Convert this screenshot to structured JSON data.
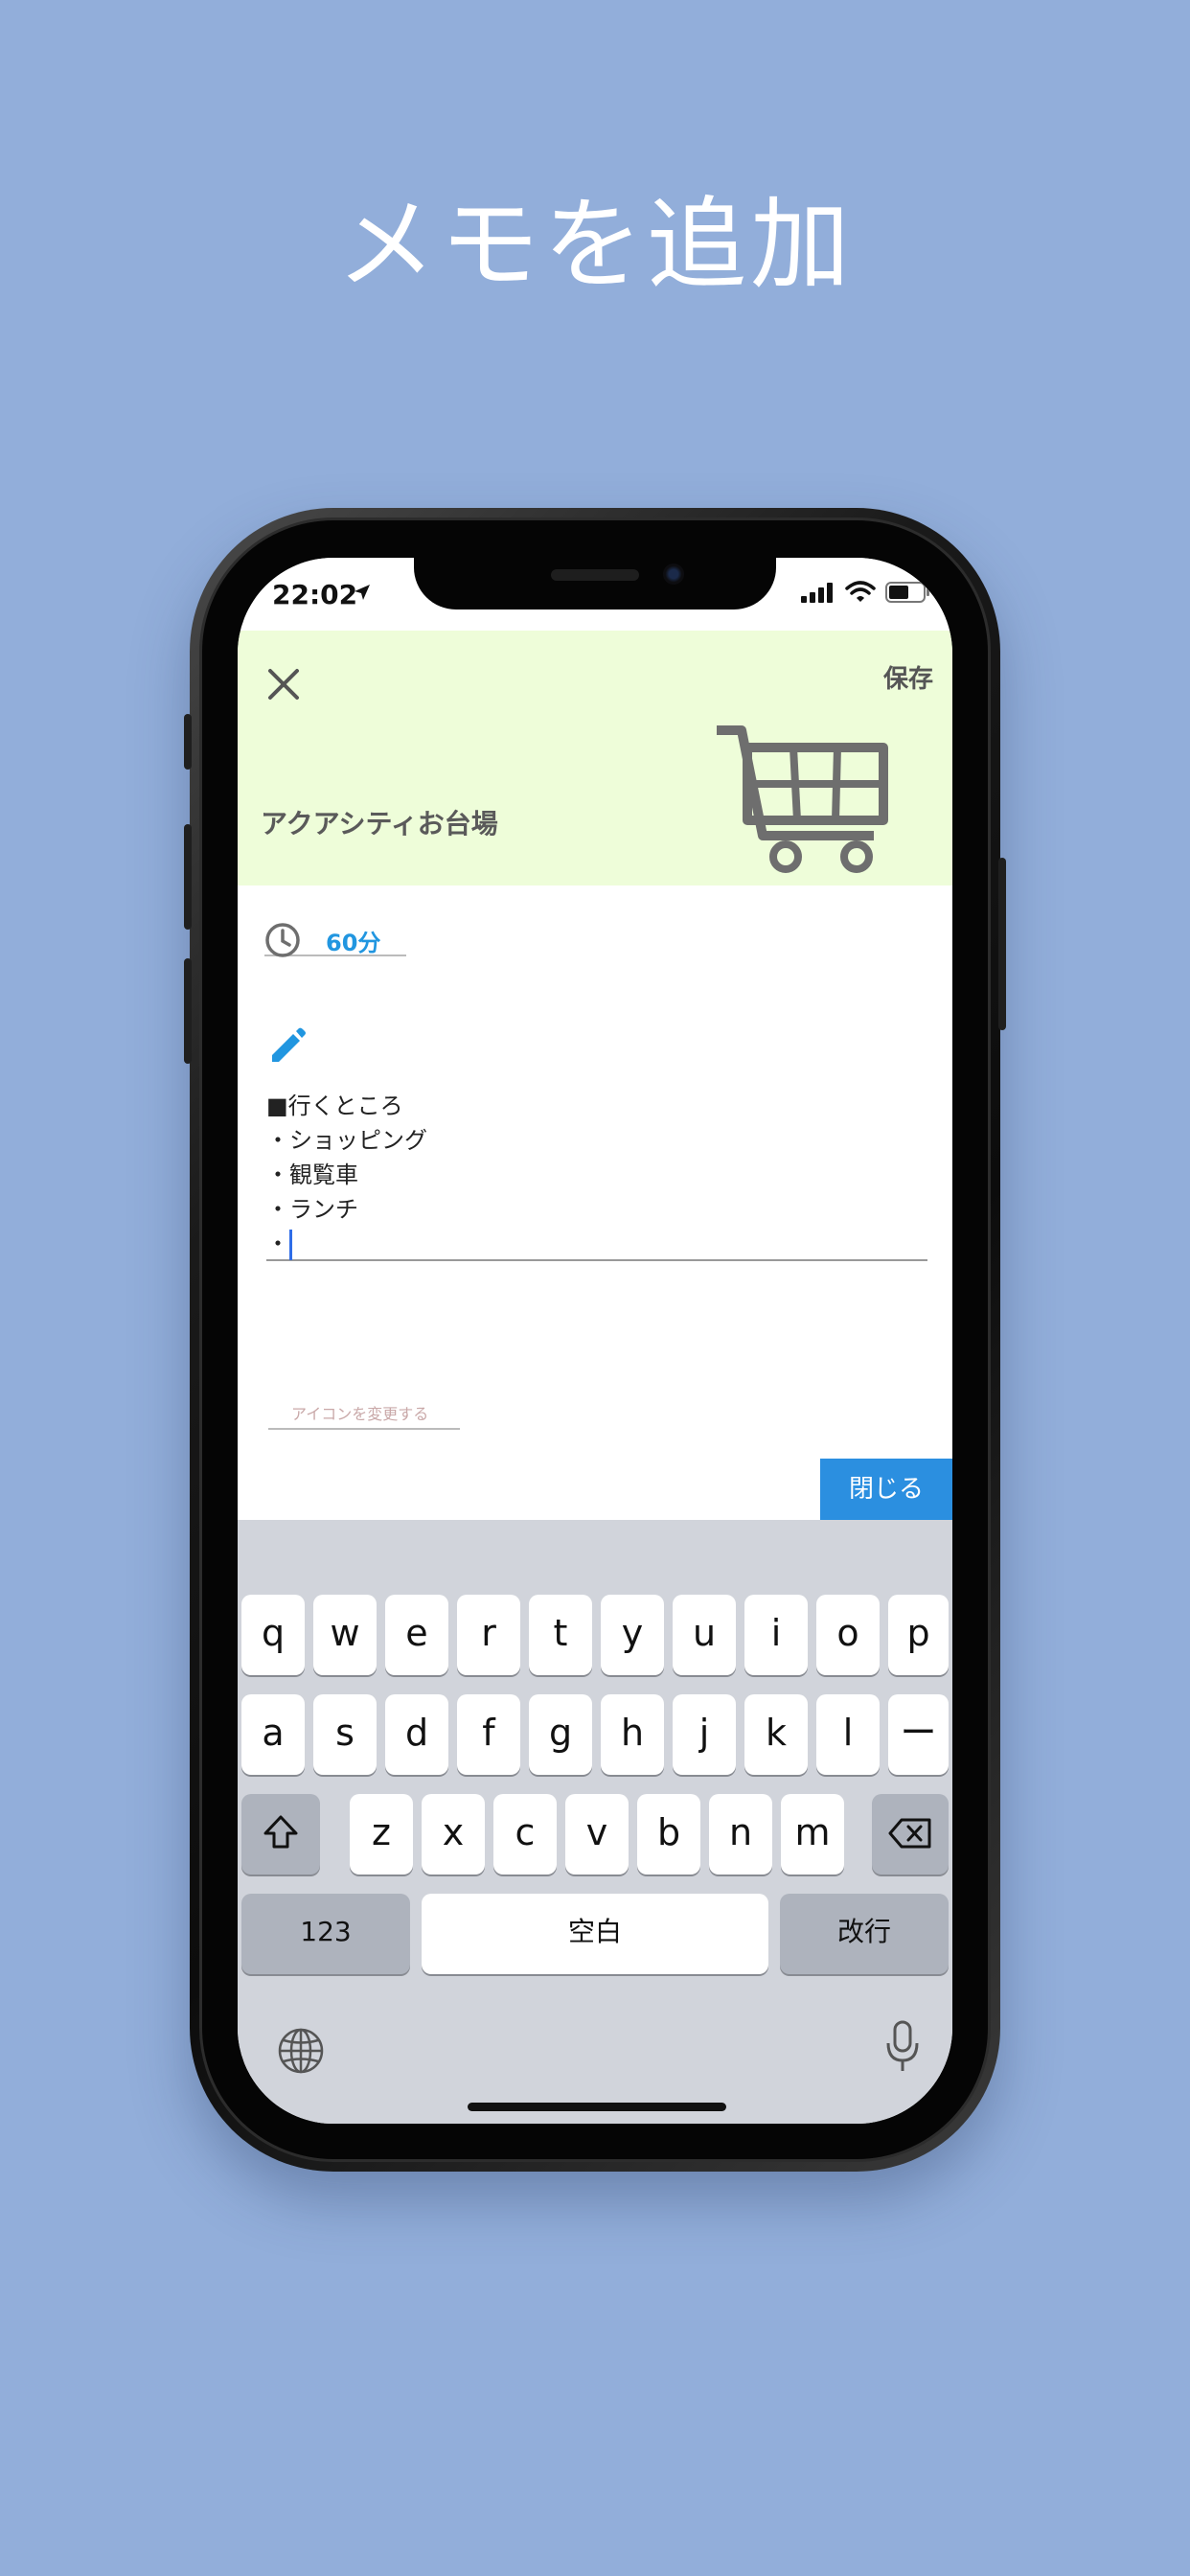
{
  "headline": "メモを追加",
  "status_bar": {
    "time": "22:02"
  },
  "header": {
    "save_label": "保存",
    "place_name": "アクアシティお台場",
    "icon": "shopping-cart-icon",
    "background_color": "#eefdd9"
  },
  "duration": {
    "icon": "clock-icon",
    "value": "60分"
  },
  "memo": {
    "icon": "pencil-icon",
    "lines": [
      "■行くところ",
      "・ショッピング",
      "・観覧車",
      "・ランチ",
      "・"
    ]
  },
  "change_icon_label": "アイコンを変更する",
  "close_keyboard_label": "閉じる",
  "keyboard": {
    "row1": [
      "q",
      "w",
      "e",
      "r",
      "t",
      "y",
      "u",
      "i",
      "o",
      "p"
    ],
    "row2": [
      "a",
      "s",
      "d",
      "f",
      "g",
      "h",
      "j",
      "k",
      "l",
      "ー"
    ],
    "row3": [
      "z",
      "x",
      "c",
      "v",
      "b",
      "n",
      "m"
    ],
    "numbers_label": "123",
    "space_label": "空白",
    "return_label": "改行"
  },
  "colors": {
    "background": "#92aeda",
    "accent": "#2b8fe0",
    "duration_text": "#2196e0"
  }
}
